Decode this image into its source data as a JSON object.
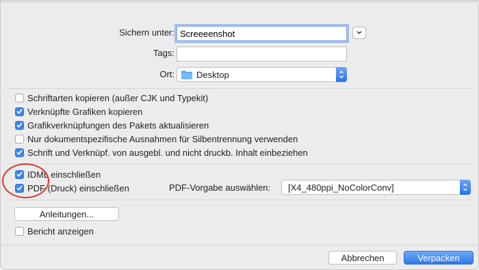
{
  "save_as": {
    "label": "Sichern unter:",
    "value": "Screeeenshot"
  },
  "tags": {
    "label": "Tags:",
    "value": ""
  },
  "location": {
    "label": "Ort:",
    "value": "Desktop",
    "icon": "folder-icon"
  },
  "options": [
    {
      "label": "Schriftarten kopieren (außer CJK und Typekit)",
      "checked": false
    },
    {
      "label": "Verknüpfte Grafiken kopieren",
      "checked": true
    },
    {
      "label": "Grafikverknüpfungen des Pakets aktualisieren",
      "checked": true
    },
    {
      "label": "Nur dokumentspezifische Ausnahmen für Silbentrennung verwenden",
      "checked": false
    },
    {
      "label": "Schrift und Verknüpf. von ausgebl. und nicht druckb. Inhalt einbeziehen",
      "checked": true
    }
  ],
  "include": [
    {
      "label": "IDML einschließen",
      "checked": true
    },
    {
      "label": "PDF (Druck) einschließen",
      "checked": true
    }
  ],
  "pdf_preset": {
    "label": "PDF-Vorgabe auswählen:",
    "value": "[X4_480ppi_NoColorConv]"
  },
  "instructions_button": "Anleitungen...",
  "report": {
    "label": "Bericht anzeigen",
    "checked": false
  },
  "footer": {
    "cancel": "Abbrechen",
    "confirm": "Verpacken"
  },
  "colors": {
    "accent": "#3b86f0",
    "annotation": "#e0312a"
  }
}
